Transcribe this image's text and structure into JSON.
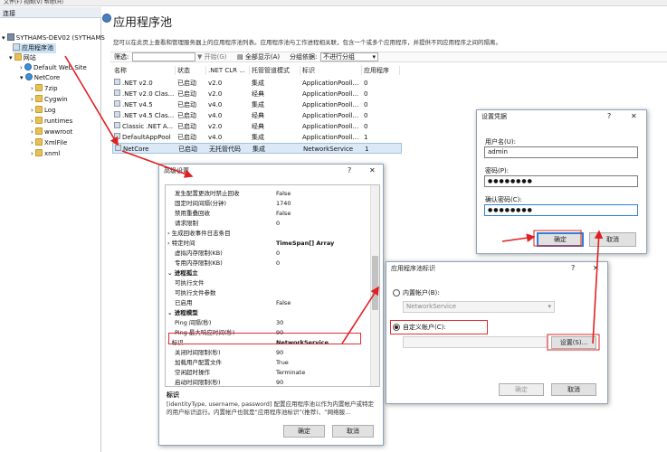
{
  "topbar": {
    "text": "文件(F)  视图(V)  帮助(H)"
  },
  "left": {
    "header": "连接",
    "tree": [
      {
        "label": "SYTHAMS-DEV02 (SYTHAMS",
        "icon": "server-icon"
      },
      {
        "label": "应用程序池",
        "icon": "app-pool-icon"
      },
      {
        "label": "网站",
        "icon": "folder-icon"
      },
      {
        "label": "Default Web Site",
        "icon": "globe-icon"
      },
      {
        "label": "NetCore",
        "icon": "globe-icon"
      },
      {
        "label": "7zip",
        "icon": "folder-icon"
      },
      {
        "label": "Cygwin",
        "icon": "folder-icon"
      },
      {
        "label": "Log",
        "icon": "folder-icon"
      },
      {
        "label": "runtimes",
        "icon": "folder-icon"
      },
      {
        "label": "wwwroot",
        "icon": "folder-icon"
      },
      {
        "label": "XmlFile",
        "icon": "folder-icon"
      },
      {
        "label": "xnml",
        "icon": "folder-icon"
      }
    ]
  },
  "main": {
    "title": "应用程序池",
    "description": "您可以在此页上查看和管理服务器上的应用程序池列表。应用程序池与工作进程相关联，包含一个或多个应用程序，并提供不同应用程序之间的隔离。",
    "filter": {
      "label": "筛选:",
      "start": "开始(G)",
      "show_all": "全部显示(A)",
      "group_label": "分组依据:",
      "group_value": "不进行分组"
    },
    "columns": [
      "名称",
      "状态",
      ".NET CLR ...",
      "托管管道模式",
      "标识",
      "应用程序"
    ],
    "rows": [
      [
        ".NET v2.0",
        "已启动",
        "v2.0",
        "集成",
        "ApplicationPooll...",
        "0"
      ],
      [
        ".NET v2.0 Clas...",
        "已启动",
        "v2.0",
        "经典",
        "ApplicationPooll...",
        "0"
      ],
      [
        ".NET v4.5",
        "已启动",
        "v4.0",
        "集成",
        "ApplicationPooll...",
        "0"
      ],
      [
        ".NET v4.5 Clas...",
        "已启动",
        "v4.0",
        "经典",
        "ApplicationPooll...",
        "0"
      ],
      [
        "Classic .NET A...",
        "已启动",
        "v2.0",
        "经典",
        "ApplicationPooll...",
        "0"
      ],
      [
        "DefaultAppPool",
        "已启动",
        "v4.0",
        "集成",
        "ApplicationPooll...",
        "1"
      ],
      [
        "NetCore",
        "已启动",
        "无托管代码",
        "集成",
        "NetworkService",
        "1"
      ]
    ]
  },
  "advanced": {
    "title": "高级设置",
    "help": "?",
    "close": "✕",
    "props": [
      {
        "k": "发生配置更改时禁止回收",
        "v": "False"
      },
      {
        "k": "固定时间间隔(分钟)",
        "v": "1740"
      },
      {
        "k": "禁用重叠回收",
        "v": "False"
      },
      {
        "k": "请求限制",
        "v": "0"
      },
      {
        "k": "生成回收事件日志条目",
        "v": ""
      },
      {
        "k": "特定时间",
        "v": "TimeSpan[] Array"
      },
      {
        "k": "虚拟内存限制(KB)",
        "v": "0"
      },
      {
        "k": "专用内存限制(KB)",
        "v": "0"
      },
      {
        "k": "进程孤立",
        "v": ""
      },
      {
        "k": "可执行文件",
        "v": ""
      },
      {
        "k": "可执行文件参数",
        "v": ""
      },
      {
        "k": "已启用",
        "v": "False"
      },
      {
        "k": "进程模型",
        "v": ""
      },
      {
        "k": "Ping 间隔(秒)",
        "v": "30"
      },
      {
        "k": "Ping 最大响应时间(秒)",
        "v": "90"
      },
      {
        "k": "标识",
        "v": "NetworkService"
      },
      {
        "k": "关闭时间限制(秒)",
        "v": "90"
      },
      {
        "k": "加载用户配置文件",
        "v": "True"
      },
      {
        "k": "空闲超时操作",
        "v": "Terminate"
      },
      {
        "k": "启动时间限制(秒)",
        "v": "90"
      }
    ],
    "desc_title": "标识",
    "desc_text": "[identityType, username, password] 配置应用程序池以作为内置帐户或特定的用户标识运行。内置帐户也就是“应用程序池标识”(推荐)、“网络服...",
    "ok": "确定",
    "cancel": "取消"
  },
  "identity": {
    "title": "应用程序池标识",
    "help": "?",
    "close": "✕",
    "builtin_label": "内置帐户(B):",
    "builtin_value": "NetworkService",
    "custom_label": "自定义帐户(C):",
    "set_button": "设置(S)...",
    "ok": "确定",
    "cancel": "取消"
  },
  "credentials": {
    "title": "设置凭据",
    "help": "?",
    "close": "✕",
    "username_label": "用户名(U):",
    "username": "admin",
    "password_label": "密码(P):",
    "password": "●●●●●●●●",
    "confirm_label": "确认密码(C):",
    "confirm": "●●●●●●●●",
    "ok": "确定",
    "cancel": "取消"
  },
  "colors": {
    "arrow": "#e02020",
    "selection": "#cce4f7",
    "primary_border": "#2f80d4"
  }
}
